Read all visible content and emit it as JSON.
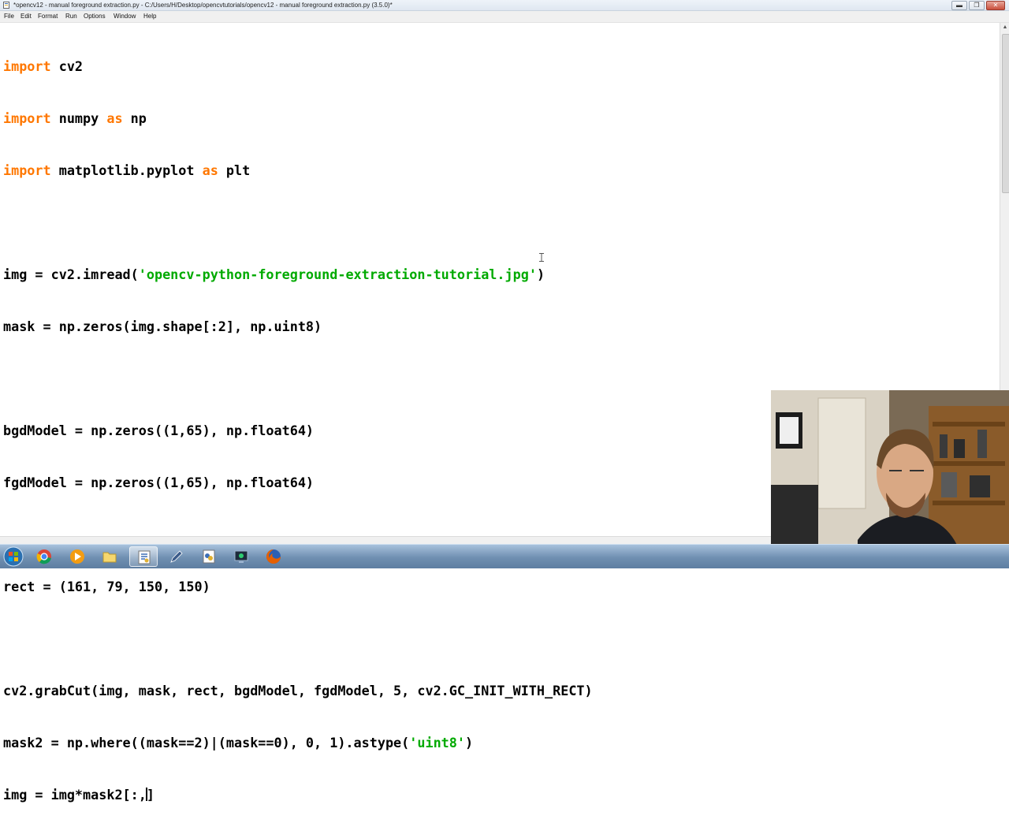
{
  "window": {
    "title": "*opencv12 - manual foreground extraction.py - C:/Users/H/Desktop/opencvtutorials/opencv12 - manual foreground extraction.py (3.5.0)*",
    "minimize_label": "▬",
    "maximize_label": "❐",
    "close_label": "✕"
  },
  "menu": {
    "items": [
      "File",
      "Edit",
      "Format",
      "Run",
      "Options",
      "Window",
      "Help"
    ]
  },
  "code": {
    "line1": {
      "kw": "import",
      "rest": " cv2"
    },
    "line2": {
      "kw1": "import",
      "mid": " numpy ",
      "kw2": "as",
      "rest": " np"
    },
    "line3": {
      "kw1": "import",
      "mid": " matplotlib.pyplot ",
      "kw2": "as",
      "rest": " plt"
    },
    "line5": {
      "pre": "img = cv2.imread(",
      "str": "'opencv-python-foreground-extraction-tutorial.jpg'",
      "post": ")"
    },
    "line6": "mask = np.zeros(img.shape[:2], np.uint8)",
    "line8": "bgdModel = np.zeros((1,65), np.float64)",
    "line9": "fgdModel = np.zeros((1,65), np.float64)",
    "line11": "rect = (161, 79, 150, 150)",
    "line13": "cv2.grabCut(img, mask, rect, bgdModel, fgdModel, 5, cv2.GC_INIT_WITH_RECT)",
    "line14": {
      "pre": "mask2 = np.where((mask==2)|(mask==0), 0, 1).astype(",
      "str": "'uint8'",
      "post": ")"
    },
    "line15": {
      "pre": "img = img*mask2[:,",
      "post": "]"
    }
  },
  "taskbar": {
    "icons": [
      "windows-start-icon",
      "chrome-icon",
      "media-player-icon",
      "file-explorer-icon",
      "python-idle-icon",
      "pen-tool-icon",
      "python-file-icon",
      "screen-recorder-icon",
      "firefox-icon"
    ],
    "active_icon": "python-idle-icon"
  },
  "colors": {
    "keyword": "#ff7700",
    "string": "#00aa00",
    "text": "#000000"
  }
}
